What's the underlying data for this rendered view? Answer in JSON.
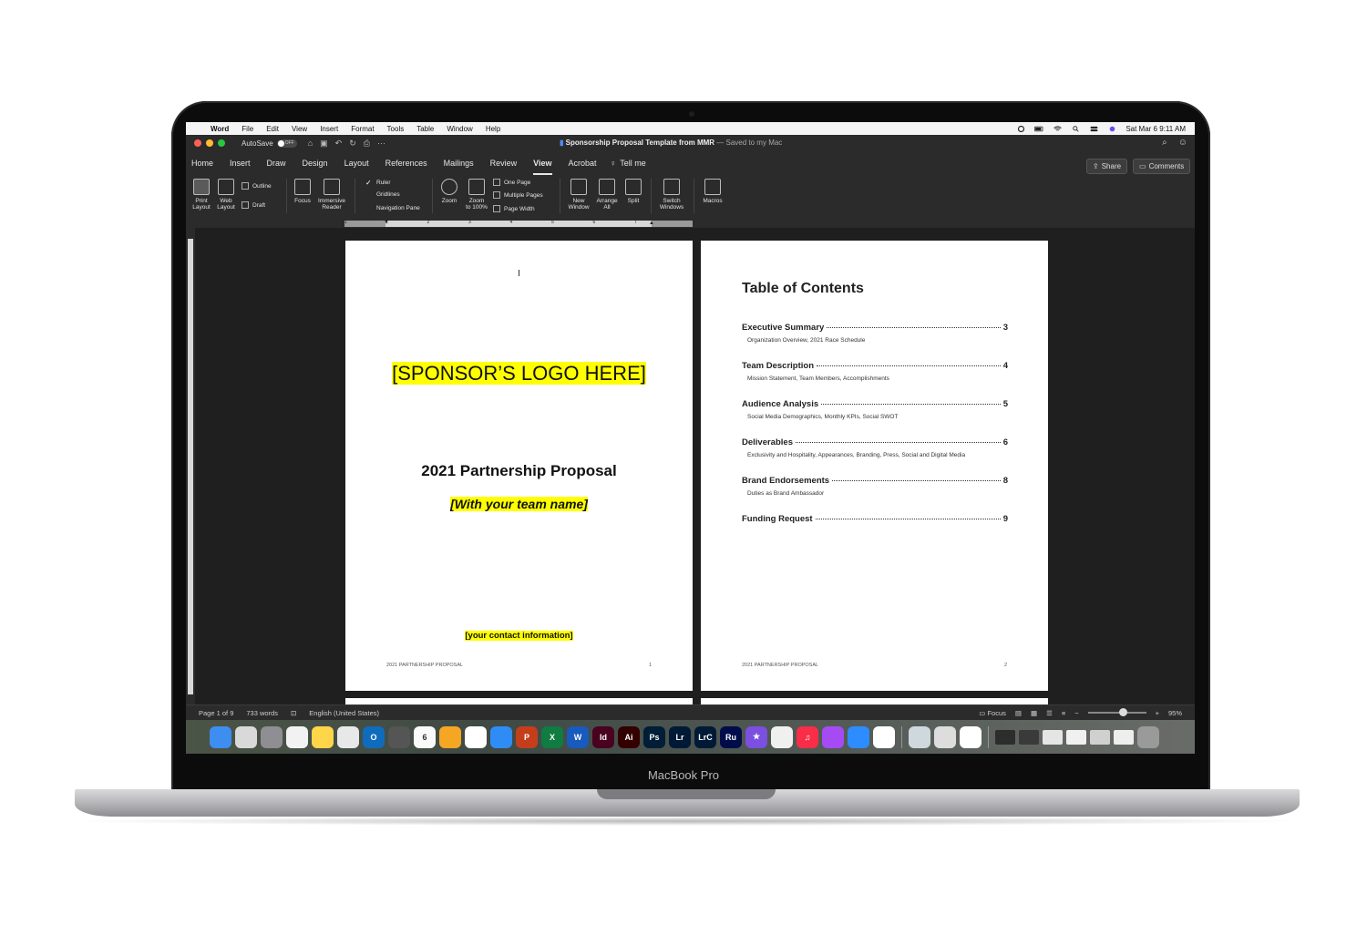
{
  "laptop": {
    "brand_label": "MacBook Pro"
  },
  "menubar": {
    "apple_glyph": "",
    "app_name": "Word",
    "items": [
      "File",
      "Edit",
      "View",
      "Insert",
      "Format",
      "Tools",
      "Table",
      "Window",
      "Help"
    ],
    "datetime": "Sat Mar 6  9:11 AM"
  },
  "titlebar": {
    "autosave_label": "AutoSave",
    "autosave_state": "OFF",
    "doc_name": "Sponsorship Proposal Template from MMR",
    "saved_status": " — Saved to my Mac"
  },
  "ribbon_tabs": [
    "Home",
    "Insert",
    "Draw",
    "Design",
    "Layout",
    "References",
    "Mailings",
    "Review",
    "View",
    "Acrobat"
  ],
  "active_tab": "View",
  "tell_me": "Tell me",
  "share_label": "Share",
  "comments_label": "Comments",
  "ribbon": {
    "print_layout": [
      "Print",
      "Layout"
    ],
    "web_layout": [
      "Web",
      "Layout"
    ],
    "outline": "Outline",
    "draft": "Draft",
    "focus": "Focus",
    "immersive_reader": [
      "Immersive",
      "Reader"
    ],
    "ruler": "Ruler",
    "gridlines": "Gridlines",
    "navigation_pane": "Navigation Pane",
    "zoom": "Zoom",
    "zoom_100": [
      "Zoom",
      "to 100%"
    ],
    "one_page": "One Page",
    "multiple_pages": "Multiple Pages",
    "page_width": "Page Width",
    "new_window": [
      "New",
      "Window"
    ],
    "arrange_all": [
      "Arrange",
      "All"
    ],
    "split": "Split",
    "switch_windows": [
      "Switch",
      "Windows"
    ],
    "macros": "Macros"
  },
  "ruler_numbers": [
    "1",
    "1",
    "2",
    "3",
    "4",
    "5",
    "6",
    "7"
  ],
  "page1": {
    "logo_placeholder": "[SPONSOR’S LOGO HERE]",
    "title": "2021 Partnership Proposal",
    "team_placeholder": "[With your team name]",
    "contact_placeholder": "[your contact information]",
    "footer_left": "2021 PARTNERSHIP PROPOSAL",
    "footer_page": "1"
  },
  "page2": {
    "toc_title": "Table of Contents",
    "entries": [
      {
        "title": "Executive Summary",
        "page": "3",
        "sub": "Organization Overview, 2021 Race Schedule"
      },
      {
        "title": "Team Description",
        "page": "4",
        "sub": "Mission Statement, Team Members, Accomplishments"
      },
      {
        "title": "Audience Analysis",
        "page": "5",
        "sub": "Social Media Demographics, Monthly KPIs, Social SWOT"
      },
      {
        "title": "Deliverables",
        "page": "6",
        "sub": "Exclusivity and Hospitality, Appearances, Branding, Press, Social and Digital Media"
      },
      {
        "title": "Brand Endorsements",
        "page": "8",
        "sub": "Duties as Brand Ambassador"
      },
      {
        "title": "Funding Request",
        "page": "9",
        "sub": ""
      }
    ],
    "footer_left": "2021 PARTNERSHIP PROPOSAL",
    "footer_page": "2"
  },
  "statusbar": {
    "page_info": "Page 1 of 9",
    "word_count": "733 words",
    "language": "English (United States)",
    "focus": "Focus",
    "zoom_minus": "−",
    "zoom_plus": "+",
    "zoom_level": "95%"
  },
  "dock": [
    {
      "name": "finder",
      "label": "",
      "color": "#3d8ef0"
    },
    {
      "name": "launchpad",
      "label": "",
      "color": "#d9d9d9"
    },
    {
      "name": "system-preferences",
      "label": "",
      "color": "#8e8e93"
    },
    {
      "name": "reminders",
      "label": "",
      "color": "#f2f2f2"
    },
    {
      "name": "notes",
      "label": "",
      "color": "#ffd54a"
    },
    {
      "name": "chrome",
      "label": "",
      "color": "#e8e8e8"
    },
    {
      "name": "outlook",
      "label": "O",
      "color": "#0f6cbd"
    },
    {
      "name": "calculator",
      "label": "",
      "color": "#555555"
    },
    {
      "name": "calendar",
      "label": "6",
      "color": "#fafafa"
    },
    {
      "name": "pages",
      "label": "",
      "color": "#f5a623"
    },
    {
      "name": "numbers",
      "label": "",
      "color": "#ffffff"
    },
    {
      "name": "keynote",
      "label": "",
      "color": "#2f8cf5"
    },
    {
      "name": "powerpoint",
      "label": "P",
      "color": "#c43e1c"
    },
    {
      "name": "excel",
      "label": "X",
      "color": "#107c41"
    },
    {
      "name": "word",
      "label": "W",
      "color": "#185abd"
    },
    {
      "name": "indesign",
      "label": "Id",
      "color": "#49021f"
    },
    {
      "name": "illustrator",
      "label": "Ai",
      "color": "#330000"
    },
    {
      "name": "photoshop",
      "label": "Ps",
      "color": "#001e36"
    },
    {
      "name": "lightroom",
      "label": "Lr",
      "color": "#001a36"
    },
    {
      "name": "lightroom-classic",
      "label": "LrC",
      "color": "#001a36"
    },
    {
      "name": "rush",
      "label": "Ru",
      "color": "#000c4a"
    },
    {
      "name": "imovie",
      "label": "★",
      "color": "#7b4fe0"
    },
    {
      "name": "acrobat",
      "label": "",
      "color": "#f0f0f0"
    },
    {
      "name": "music",
      "label": "♫",
      "color": "#fa2d48"
    },
    {
      "name": "podcasts",
      "label": "",
      "color": "#a64bf4"
    },
    {
      "name": "zoom",
      "label": "",
      "color": "#2d8cff"
    },
    {
      "name": "clickup",
      "label": "",
      "color": "#ffffff"
    }
  ],
  "dock_right": [
    {
      "name": "quicktime",
      "color": "#cfd8dc"
    },
    {
      "name": "preview",
      "color": "#dddddd"
    },
    {
      "name": "messenger",
      "color": "#ffffff"
    }
  ],
  "dock_windows": [
    {
      "name": "minimized-window",
      "color": "#2d2d2d"
    },
    {
      "name": "minimized-window",
      "color": "#3a3a3a"
    },
    {
      "name": "minimized-window",
      "color": "#e5e5e5"
    },
    {
      "name": "minimized-window",
      "color": "#f0f0f0"
    },
    {
      "name": "minimized-window",
      "color": "#d0d0d0"
    },
    {
      "name": "minimized-window",
      "color": "#eeeeee"
    }
  ]
}
